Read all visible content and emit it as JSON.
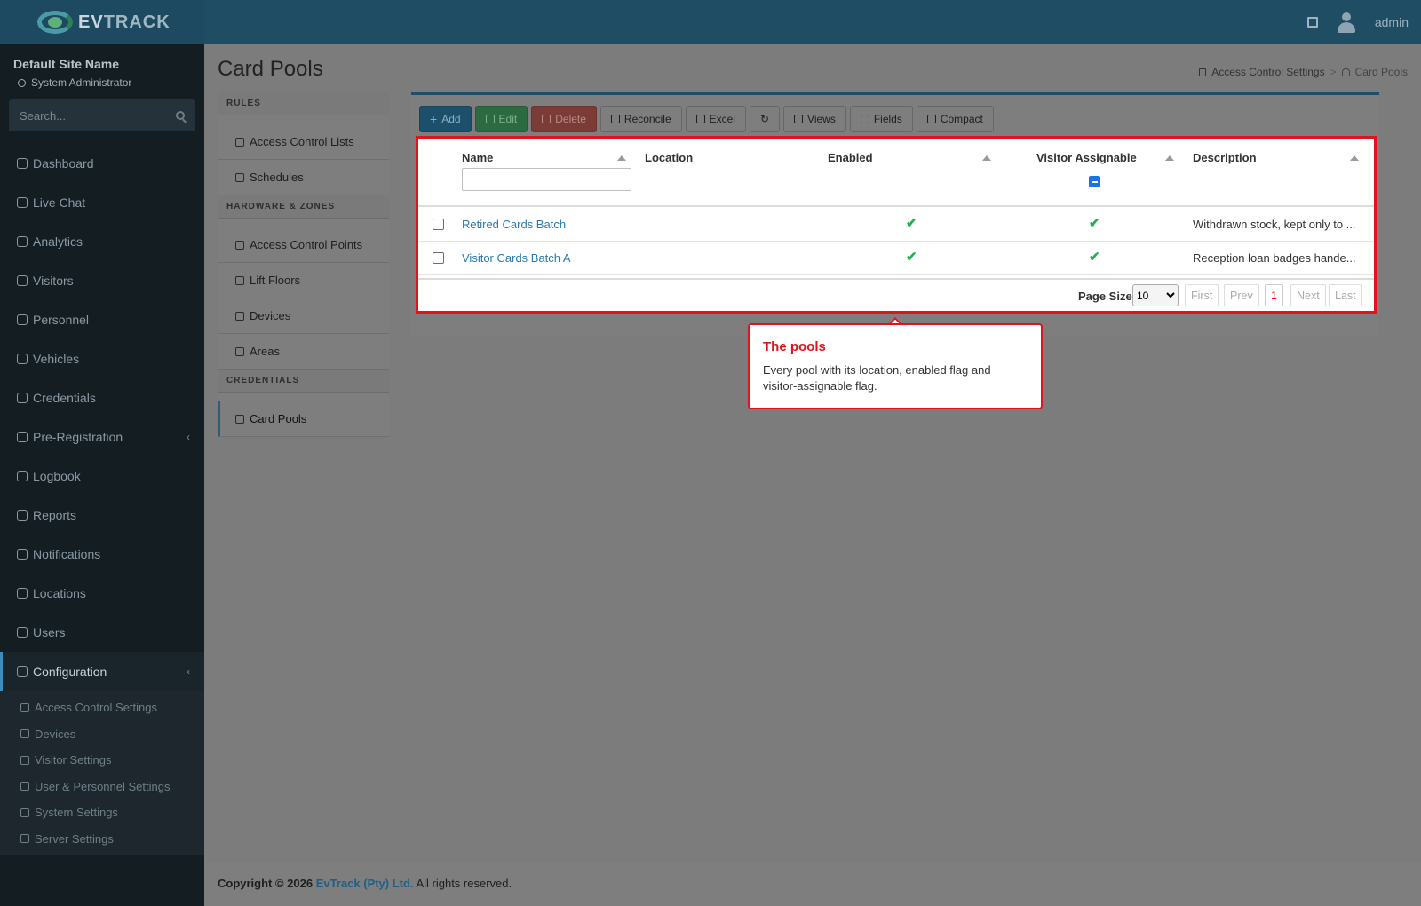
{
  "header": {
    "logo_prefix": "EV",
    "logo_suffix": "TRACK",
    "user": "admin",
    "icons": [
      "book-icon",
      "user-avatar-icon"
    ]
  },
  "sidebar": {
    "site_name": "Default Site Name",
    "role": "System Administrator",
    "search_placeholder": "Search...",
    "nav": [
      {
        "label": "Dashboard",
        "icon": "dashboard-icon"
      },
      {
        "label": "Live Chat",
        "icon": "headset-icon"
      },
      {
        "label": "Analytics",
        "icon": "analytics-icon"
      },
      {
        "label": "Visitors",
        "icon": "eye-icon"
      },
      {
        "label": "Personnel",
        "icon": "personnel-icon"
      },
      {
        "label": "Vehicles",
        "icon": "vehicle-icon"
      },
      {
        "label": "Credentials",
        "icon": "credentials-icon"
      },
      {
        "label": "Pre-Registration",
        "icon": "pre-registration-icon",
        "expandable": true
      },
      {
        "label": "Logbook",
        "icon": "logbook-icon"
      },
      {
        "label": "Reports",
        "icon": "reports-icon"
      },
      {
        "label": "Notifications",
        "icon": "notifications-icon"
      },
      {
        "label": "Locations",
        "icon": "locations-icon"
      },
      {
        "label": "Users",
        "icon": "users-icon"
      },
      {
        "label": "Configuration",
        "icon": "gear-icon",
        "expandable": true,
        "active": true
      }
    ],
    "subnav": [
      {
        "label": "Access Control Settings",
        "icon": "lock-icon"
      },
      {
        "label": "Devices",
        "icon": "device-icon"
      },
      {
        "label": "Visitor Settings",
        "icon": "eye-icon"
      },
      {
        "label": "User & Personnel Settings",
        "icon": "user-gear-icon"
      },
      {
        "label": "System Settings",
        "icon": "sliders-icon"
      },
      {
        "label": "Server Settings",
        "icon": "server-icon"
      }
    ]
  },
  "page": {
    "title": "Card Pools",
    "breadcrumb": [
      "Access Control Settings",
      "Card Pools"
    ]
  },
  "settings_menu": {
    "sections": [
      {
        "header": "RULES",
        "items": [
          "Access Control Lists",
          "Schedules"
        ]
      },
      {
        "header": "HARDWARE & ZONES",
        "items": [
          "Access Control Points",
          "Lift Floors",
          "Devices",
          "Areas"
        ]
      },
      {
        "header": "CREDENTIALS",
        "items": [
          "Card Pools"
        ]
      }
    ],
    "active": "Card Pools"
  },
  "toolbar": {
    "buttons": [
      "Add",
      "Edit",
      "Delete",
      "Reconcile",
      "Excel",
      "",
      "Views",
      "Fields",
      "Compact"
    ]
  },
  "grid": {
    "columns": [
      "Name",
      "Location",
      "Enabled",
      "Visitor Assignable",
      "Description"
    ],
    "rows": [
      {
        "name": "Retired Cards Batch",
        "location": "",
        "enabled": true,
        "visitor_assignable": true,
        "description": "Withdrawn stock, kept only to ..."
      },
      {
        "name": "Visitor Cards Batch A",
        "location": "",
        "enabled": true,
        "visitor_assignable": true,
        "description": "Reception loan badges hande..."
      }
    ],
    "pager": {
      "label": "Page Size",
      "page_size": "10",
      "page_size_options": [
        "10"
      ],
      "first": "First",
      "prev": "Prev",
      "current": "1",
      "next": "Next",
      "last": "Last"
    }
  },
  "tooltip": {
    "title": "The pools",
    "text": "Every pool with its location, enabled flag and visitor-assignable flag."
  },
  "footer": {
    "prefix": "Copyright © 2026",
    "company": "EvTrack (Pty) Ltd.",
    "suffix": "All rights reserved."
  },
  "colors": {
    "accent": "#3c8dbc",
    "highlight": "#e0141e",
    "check": "#22b04b",
    "link": "#2a7ab0"
  }
}
